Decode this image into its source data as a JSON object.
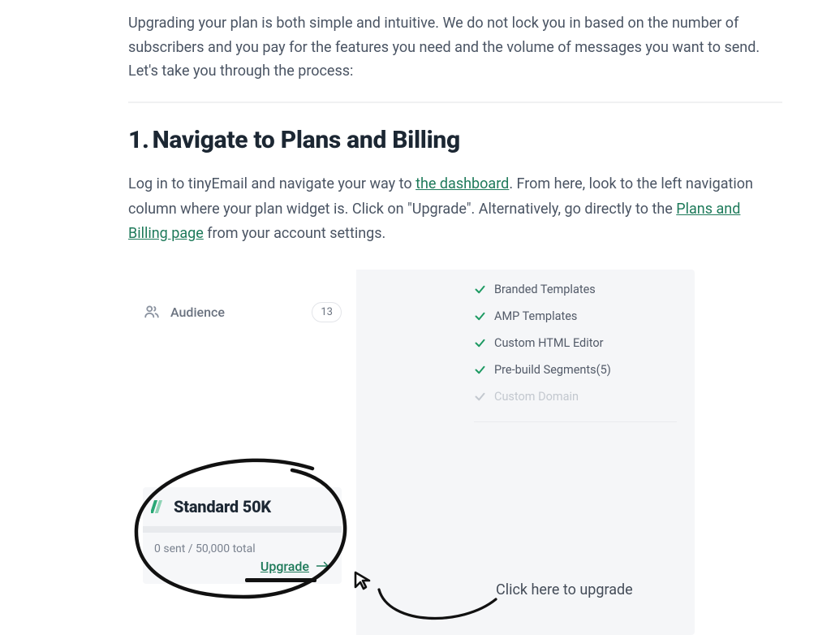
{
  "intro": "Upgrading your plan is both simple and intuitive. We do not lock you in based on the number of subscribers and you pay for the features you need and the volume of messages you want to send. Let's take you through the process:",
  "section": {
    "number": "1.",
    "title": "Navigate to Plans and Billing",
    "p1a": "Log in to tinyEmail and navigate your way to ",
    "link1": "the dashboard",
    "p1b": ". From here, look to the left navigation column where your plan widget is. Click on \"Upgrade\". Alternatively, go directly to the ",
    "link2": "Plans and Billing page",
    "p1c": " from your account settings."
  },
  "sidebar": {
    "audience_label": "Audience",
    "audience_count": "13"
  },
  "features": {
    "items": [
      "Branded Templates",
      "AMP Templates",
      "Custom HTML Editor",
      "Pre-build Segments(5)",
      "Custom Domain"
    ]
  },
  "plan": {
    "name": "Standard 50K",
    "usage": "0 sent / 50,000 total",
    "upgrade_label": "Upgrade"
  },
  "annotation": {
    "cta": "Click here to upgrade"
  }
}
